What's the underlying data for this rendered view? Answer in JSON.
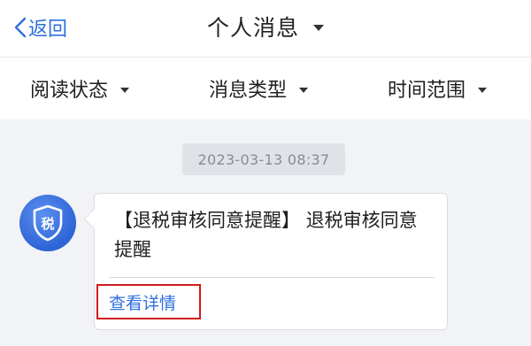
{
  "nav": {
    "back_label": "返回",
    "title": "个人消息"
  },
  "filters": [
    {
      "label": "阅读状态"
    },
    {
      "label": "消息类型"
    },
    {
      "label": "时间范围"
    }
  ],
  "message": {
    "timestamp": "2023-03-13 08:37",
    "avatar_text": "税",
    "text": "【退税审核同意提醒】 退税审核同意提醒",
    "detail_label": "查看详情"
  },
  "colors": {
    "accent": "#2f6fe0",
    "highlight_border": "#d01a1a",
    "background": "#f2f3f7"
  }
}
